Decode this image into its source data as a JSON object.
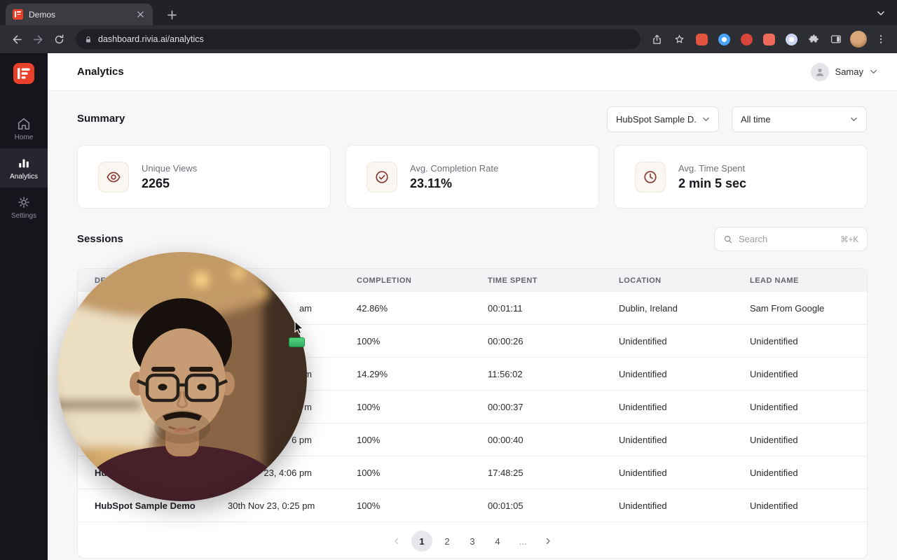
{
  "browser": {
    "tab_title": "Demos",
    "url": "dashboard.rivia.ai/analytics"
  },
  "sidebar": {
    "items": [
      {
        "label": "Home",
        "icon": "home-icon",
        "active": false
      },
      {
        "label": "Analytics",
        "icon": "bar-chart-icon",
        "active": true
      },
      {
        "label": "Settings",
        "icon": "gear-icon",
        "active": false
      }
    ]
  },
  "header": {
    "title": "Analytics",
    "user_name": "Samay"
  },
  "summary": {
    "heading": "Summary",
    "demo_filter_value": "HubSpot Sample D...",
    "time_filter_value": "All time",
    "cards": [
      {
        "label": "Unique Views",
        "value": "2265",
        "icon": "eye-icon"
      },
      {
        "label": "Avg. Completion Rate",
        "value": "23.11%",
        "icon": "check-circle-icon"
      },
      {
        "label": "Avg. Time Spent",
        "value": "2 min 5 sec",
        "icon": "clock-icon"
      }
    ]
  },
  "sessions": {
    "heading": "Sessions",
    "search_placeholder": "Search",
    "search_shortcut": "⌘+K",
    "table": {
      "headers": [
        "DEMO",
        "",
        "COMPLETION",
        "TIME SPENT",
        "LOCATION",
        "LEAD NAME"
      ],
      "rows": [
        {
          "demo": "",
          "date": "am",
          "completion": "42.86%",
          "time_spent": "00:01:11",
          "location": "Dublin, Ireland",
          "lead_name": "Sam From Google"
        },
        {
          "demo": "",
          "date": "",
          "completion": "100%",
          "time_spent": "00:00:26",
          "location": "Unidentified",
          "lead_name": "Unidentified"
        },
        {
          "demo": "",
          "date": "m",
          "completion": "14.29%",
          "time_spent": "11:56:02",
          "location": "Unidentified",
          "lead_name": "Unidentified"
        },
        {
          "demo": "",
          "date": "m",
          "completion": "100%",
          "time_spent": "00:00:37",
          "location": "Unidentified",
          "lead_name": "Unidentified"
        },
        {
          "demo": "",
          "date": "6 pm",
          "completion": "100%",
          "time_spent": "00:00:40",
          "location": "Unidentified",
          "lead_name": "Unidentified"
        },
        {
          "demo": "Hu",
          "date": "23, 4:06 pm",
          "completion": "100%",
          "time_spent": "17:48:25",
          "location": "Unidentified",
          "lead_name": "Unidentified"
        },
        {
          "demo": "HubSpot Sample Demo",
          "date": "30th Nov 23, 0:25 pm",
          "completion": "100%",
          "time_spent": "00:01:05",
          "location": "Unidentified",
          "lead_name": "Unidentified"
        }
      ]
    },
    "pagination": {
      "pages": [
        "1",
        "2",
        "3",
        "4",
        "..."
      ],
      "active": "1"
    }
  },
  "colors": {
    "brand_red": "#e8402a",
    "stat_icon": "#87382f",
    "sidebar_bg": "#15151b"
  }
}
